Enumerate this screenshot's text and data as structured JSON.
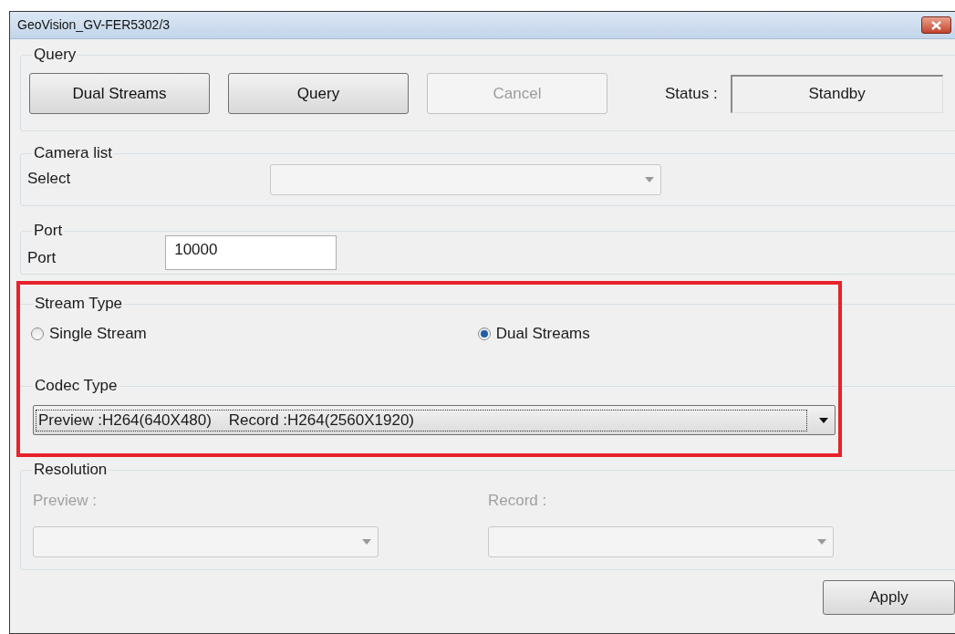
{
  "window": {
    "title": "GeoVision_GV-FER5302/3"
  },
  "query": {
    "legend": "Query",
    "buttons": [
      {
        "label": "Dual Streams",
        "disabled": false
      },
      {
        "label": "Query",
        "disabled": false
      },
      {
        "label": "Cancel",
        "disabled": true
      }
    ],
    "status_label": "Status :",
    "status": "Standby"
  },
  "camera_list": {
    "legend": "Camera list",
    "select_label": "Select",
    "select_disabled": true
  },
  "port": {
    "legend": "Port",
    "label": "Port",
    "value": "10000"
  },
  "stream_type": {
    "legend": "Stream Type",
    "highlighted": true,
    "options": [
      {
        "label": "Single Stream",
        "selected": false
      },
      {
        "label": "Dual Streams",
        "selected": true
      }
    ]
  },
  "codec_type": {
    "legend": "Codec Type",
    "value": "Preview :H264(640X480)    Record :H264(2560X1920)"
  },
  "resolution": {
    "legend": "Resolution",
    "fields": [
      {
        "label": "Preview :",
        "disabled": true
      },
      {
        "label": "Record :",
        "disabled": true
      }
    ]
  },
  "apply_button": "Apply"
}
